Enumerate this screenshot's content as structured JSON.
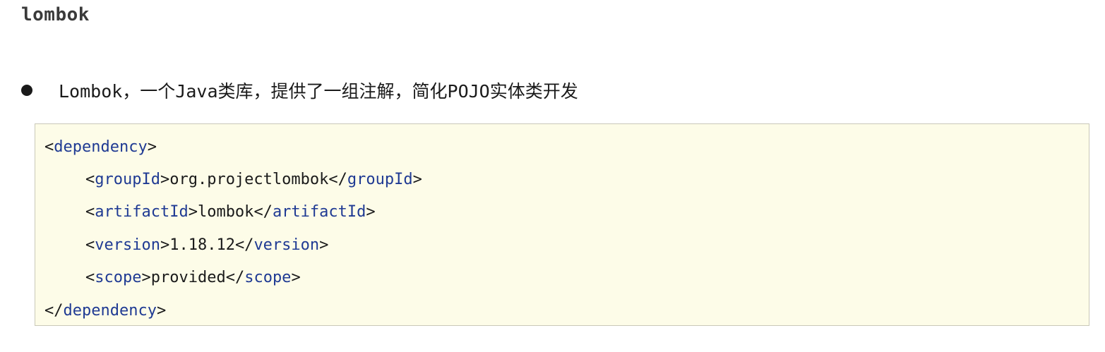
{
  "heading": "lombok",
  "bullet": {
    "text": "Lombok，一个Java类库，提供了一组注解，简化POJO实体类开发"
  },
  "code": {
    "dependency_open": {
      "lt": "<",
      "tag": "dependency",
      "gt": ">"
    },
    "groupId": {
      "open_lt": "<",
      "tag": "groupId",
      "open_gt": ">",
      "value": "org.projectlombok",
      "close_lt": "</",
      "close_gt": ">"
    },
    "artifactId": {
      "open_lt": "<",
      "tag": "artifactId",
      "open_gt": ">",
      "value": "lombok",
      "close_lt": "</",
      "close_gt": ">"
    },
    "version": {
      "open_lt": "<",
      "tag": "version",
      "open_gt": ">",
      "value": "1.18.12",
      "close_lt": "</",
      "close_gt": ">"
    },
    "scope": {
      "open_lt": "<",
      "tag": "scope",
      "open_gt": ">",
      "value": "provided",
      "close_lt": "</",
      "close_gt": ">"
    },
    "dependency_close": {
      "lt": "</",
      "tag": "dependency",
      "gt": ">"
    },
    "tag_color": "#1f3a93",
    "background_color": "#fdfce8"
  }
}
